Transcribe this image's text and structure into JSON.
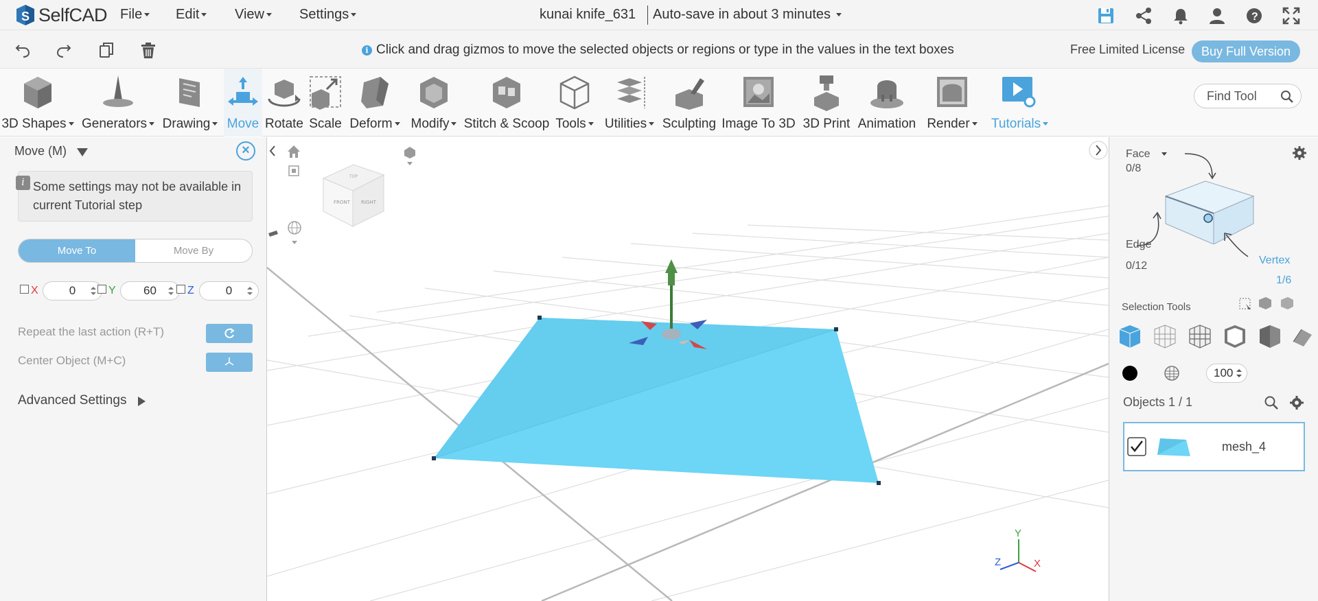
{
  "app": {
    "logo_text": "SelfCAD",
    "file_title": "kunai knife_631",
    "autosave": "Auto-save in about 3 minutes"
  },
  "menu": {
    "file": "File",
    "edit": "Edit",
    "view": "View",
    "settings": "Settings"
  },
  "subbar": {
    "hint": "Click and drag gizmos to move the selected objects or regions or type in the values in the text boxes",
    "license": "Free Limited License",
    "buy": "Buy Full Version"
  },
  "ribbon": {
    "tools": [
      {
        "label": "3D Shapes",
        "icon": "cube-icon",
        "dropdown": true
      },
      {
        "label": "Generators",
        "icon": "generator-icon",
        "dropdown": true
      },
      {
        "label": "Drawing",
        "icon": "drawing-icon",
        "dropdown": true
      },
      {
        "label": "Move",
        "icon": "move-icon",
        "dropdown": false,
        "active": true
      },
      {
        "label": "Rotate",
        "icon": "rotate-icon",
        "dropdown": false
      },
      {
        "label": "Scale",
        "icon": "scale-icon",
        "dropdown": false
      },
      {
        "label": "Deform",
        "icon": "deform-icon",
        "dropdown": true
      },
      {
        "label": "Modify",
        "icon": "modify-icon",
        "dropdown": true
      },
      {
        "label": "Stitch & Scoop",
        "icon": "stitch-scoop-icon",
        "dropdown": false
      },
      {
        "label": "Tools",
        "icon": "tools-icon",
        "dropdown": true
      },
      {
        "label": "Utilities",
        "icon": "utilities-icon",
        "dropdown": true
      },
      {
        "label": "Sculpting",
        "icon": "sculpting-icon",
        "dropdown": false
      },
      {
        "label": "Image To 3D",
        "icon": "image-to-3d-icon",
        "dropdown": false
      },
      {
        "label": "3D Print",
        "icon": "3d-print-icon",
        "dropdown": false
      },
      {
        "label": "Animation",
        "icon": "animation-icon",
        "dropdown": false
      },
      {
        "label": "Render",
        "icon": "render-icon",
        "dropdown": true
      },
      {
        "label": "Tutorials",
        "icon": "tutorials-icon",
        "dropdown": true
      }
    ],
    "find_placeholder": "Find Tool"
  },
  "left_panel": {
    "title": "Move (M)",
    "note": "Some settings may not be available in current Tutorial step",
    "mode_to": "Move To",
    "mode_by": "Move By",
    "axes": [
      {
        "label": "X",
        "value": "0",
        "color": "#e0383e"
      },
      {
        "label": "Y",
        "value": "60",
        "color": "#3aa33a"
      },
      {
        "label": "Z",
        "value": "0",
        "color": "#2b5fd9"
      }
    ],
    "repeat": "Repeat the last action (R+T)",
    "center": "Center Object (M+C)",
    "advanced": "Advanced Settings"
  },
  "viewcube": {
    "front": "FRONT",
    "right": "RIGHT",
    "top": "TOP"
  },
  "axes_gizmo": {
    "x": "X",
    "y": "Y",
    "z": "Z"
  },
  "right_panel": {
    "face_label": "Face",
    "face_count": "0/8",
    "edge_label": "Edge",
    "edge_count": "0/12",
    "vertex_label": "Vertex",
    "vertex_count": "1/6",
    "selection_tools": "Selection Tools",
    "opacity": "100",
    "objects": "Objects 1 / 1",
    "object_name": "mesh_4"
  },
  "colors": {
    "accent": "#4aa3dc",
    "mesh": "#6dd5f5",
    "button": "#79b8e0"
  }
}
